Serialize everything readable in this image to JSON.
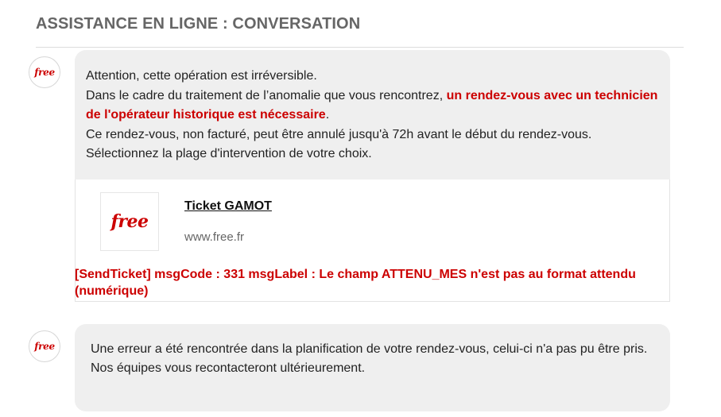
{
  "header": {
    "title": "ASSISTANCE EN LIGNE : CONVERSATION"
  },
  "messages": [
    {
      "avatar_logo": "free",
      "lines": {
        "line1": "Attention, cette opération est irréversible.",
        "line2_prefix": "Dans le cadre du traitement de l’anomalie que vous rencontrez, ",
        "line2_highlight": "un rendez-vous avec un technicien de l'opérateur historique est nécessaire",
        "line2_suffix": ".",
        "line3": "Ce rendez-vous, non facturé, peut être annulé jusqu'à 72h avant le début du rendez-vous.",
        "line4": "Sélectionnez la plage d'intervention de votre choix."
      },
      "card": {
        "logo": "free",
        "title": "Ticket GAMOT",
        "url": "www.free.fr",
        "error": "[SendTicket] msgCode : 331 msgLabel : Le champ ATTENU_MES n'est pas au format attendu (numérique)"
      }
    },
    {
      "avatar_logo": "free",
      "lines": {
        "line1": "Une erreur a été rencontrée dans la planification de votre rendez-vous, celui-ci n'a pas pu être pris.",
        "line2": "Nos équipes vous recontacteront ultérieurement."
      }
    }
  ],
  "colors": {
    "accent_red": "#cc0000",
    "bubble_bg": "#efefef",
    "header_text": "#666666"
  }
}
